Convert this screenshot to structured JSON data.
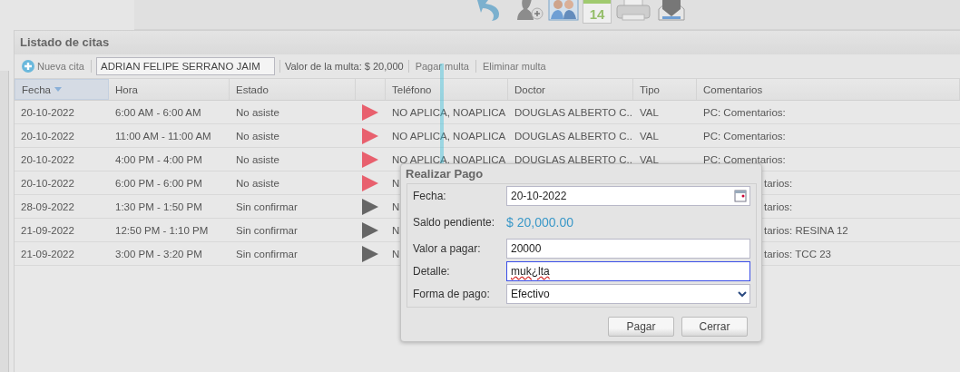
{
  "toolbar_icons": [
    {
      "kind": "back"
    },
    {
      "kind": "user-add"
    },
    {
      "kind": "people"
    },
    {
      "kind": "calendar",
      "text": "14"
    },
    {
      "kind": "printer"
    },
    {
      "kind": "house"
    }
  ],
  "panel": {
    "title": "Listado de citas"
  },
  "actions": {
    "new_button": "Nueva cita",
    "patient_field": "ADRIAN FELIPE SERRANO JAIM",
    "fine_label": "Valor de la multa: $ 20,000",
    "pay_button": "Pagar multa",
    "delete_button": "Eliminar multa"
  },
  "table": {
    "columns": [
      {
        "label": "Fecha",
        "sorted": true
      },
      {
        "label": "Hora",
        "sorted": false
      },
      {
        "label": "Estado",
        "sorted": false
      },
      {
        "sorted": false
      },
      {
        "label": "Teléfono",
        "sorted": false
      },
      {
        "label": "Doctor",
        "sorted": false
      },
      {
        "label": "Tipo",
        "sorted": false
      },
      {
        "label": "Comentarios",
        "sorted": false
      }
    ],
    "rows": [
      {
        "fecha": "20-10-2022",
        "hora": "6:00 AM - 6:00 AM",
        "estado": "No asiste",
        "color": "#e8606e",
        "telefono": "NO APLICA, NOAPLICA",
        "doctor": "DOUGLAS ALBERTO C...",
        "tipo": "VAL",
        "comentarios": "PC: Comentarios:",
        "covered": false
      },
      {
        "fecha": "20-10-2022",
        "hora": "11:00 AM - 11:00 AM",
        "estado": "No asiste",
        "color": "#e8606e",
        "telefono": "NO APLICA, NOAPLICA",
        "doctor": "DOUGLAS ALBERTO C...",
        "tipo": "VAL",
        "comentarios": "PC: Comentarios:",
        "covered": false
      },
      {
        "fecha": "20-10-2022",
        "hora": "4:00 PM - 4:00 PM",
        "estado": "No asiste",
        "color": "#e8606e",
        "telefono": "NO APLICA, NOAPLICA",
        "doctor": "DOUGLAS ALBERTO C...",
        "tipo": "VAL",
        "comentarios": "PC: Comentarios:",
        "covered": false
      },
      {
        "fecha": "20-10-2022",
        "hora": "6:00 PM - 6:00 PM",
        "estado": "No asiste",
        "color": "#e8606e",
        "telefono": "N",
        "comentarios": "tarios:",
        "covered": true
      },
      {
        "fecha": "28-09-2022",
        "hora": "1:30 PM - 1:50 PM",
        "estado": "Sin confirmar",
        "color": "#666666",
        "telefono": "N",
        "comentarios": "tarios:",
        "covered": true
      },
      {
        "fecha": "21-09-2022",
        "hora": "12:50 PM - 1:10 PM",
        "estado": "Sin confirmar",
        "color": "#666666",
        "telefono": "N",
        "comentarios": "tarios: RESINA 12",
        "covered": true
      },
      {
        "fecha": "21-09-2022",
        "hora": "3:00 PM - 3:20 PM",
        "estado": "Sin confirmar",
        "color": "#666666",
        "telefono": "N",
        "comentarios": "tarios: TCC 23",
        "covered": true
      }
    ]
  },
  "dialog": {
    "title": "Realizar Pago",
    "fields": [
      {
        "kind": "date",
        "label": "Fecha:",
        "value": "20-10-2022",
        "focused": false
      },
      {
        "kind": "amount",
        "label": "Saldo pendiente:",
        "value": "$ 20,000.00"
      },
      {
        "kind": "text",
        "label": "Valor a pagar:",
        "value": "20000",
        "focused": false
      },
      {
        "kind": "text",
        "label": "Detalle:",
        "value": "muk¿lta",
        "focused": true,
        "misspelled": true
      },
      {
        "kind": "select",
        "label": "Forma de pago:",
        "value": "Efectivo",
        "focused": false
      }
    ],
    "buttons": [
      "Pagar",
      "Cerrar"
    ]
  }
}
